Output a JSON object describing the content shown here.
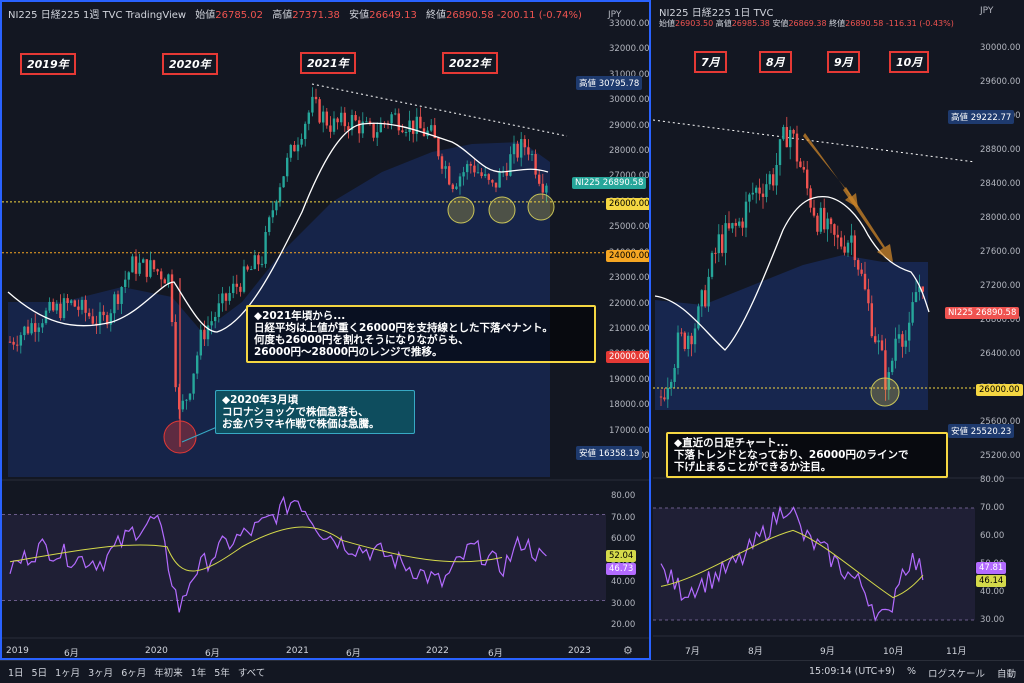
{
  "left": {
    "symbol": "NI225",
    "name": "日経225",
    "interval": "1週",
    "source": "TVC",
    "platform": "TradingView",
    "ohlc": {
      "o_label": "始値",
      "o": "26785.02",
      "h_label": "高値",
      "h": "27371.38",
      "l_label": "安値",
      "l": "26649.13",
      "c_label": "終値",
      "c": "26890.58",
      "chg": "-200.11 (-0.74%)"
    },
    "currency": "JPY",
    "price_axis": [
      "33000.00",
      "32000.00",
      "31000.00",
      "30000.00",
      "29000.00",
      "28000.00",
      "27000.00",
      "26000.00",
      "25000.00",
      "24000.00",
      "23000.00",
      "22000.00",
      "21000.00",
      "20000.00",
      "19000.00",
      "18000.00",
      "17000.00",
      "16000.00"
    ],
    "tags": {
      "high_label": "高値",
      "high": "30795.78",
      "symbol": "NI225",
      "last": "26890.58",
      "level1": "26000.00",
      "level2": "24000.00",
      "level3": "20000.00",
      "low_label": "安値",
      "low": "16358.19"
    },
    "year_labels": [
      "2019年",
      "2020年",
      "2021年",
      "2022年"
    ],
    "note_2021": {
      "title": "◆2021年頃から...",
      "l1": "日経平均は上値が重く26000円を支持線とした下落ペナント。",
      "l2": "何度も26000円を割れそうになりながらも、",
      "l3": "26000円〜28000円のレンジで推移。"
    },
    "note_2020": {
      "title": "◆2020年3月頃",
      "l1": "コロナショックで株価急落も、",
      "l2": "お金バラマキ作戦で株価は急騰。"
    },
    "rsi_axis": [
      "80.00",
      "70.00",
      "60.00",
      "50.00",
      "40.00",
      "30.00",
      "20.00"
    ],
    "rsi_tags": {
      "a": "52.04",
      "b": "46.73"
    },
    "x_labels": [
      "2019",
      "6月",
      "2020",
      "6月",
      "2021",
      "6月",
      "2022",
      "6月",
      "2023"
    ]
  },
  "right": {
    "symbol": "NI225",
    "name": "日経225",
    "interval": "1日",
    "source": "TVC",
    "ohlc": {
      "o_label": "始値",
      "o": "26903.50",
      "h_label": "高値",
      "h": "26985.38",
      "l_label": "安値",
      "l": "26869.38",
      "c_label": "終値",
      "c": "26890.58",
      "chg": "-116.31 (-0.43%)"
    },
    "currency": "JPY",
    "price_axis": [
      "30000.00",
      "29600.00",
      "29200.00",
      "28800.00",
      "28400.00",
      "28000.00",
      "27600.00",
      "27200.00",
      "26800.00",
      "26400.00",
      "26000.00",
      "25600.00",
      "25200.00"
    ],
    "tags": {
      "high_label": "高値",
      "high": "29222.77",
      "symbol": "NI225",
      "last": "26890.58",
      "level": "26000.00",
      "low_label": "安値",
      "low": "25520.23"
    },
    "month_labels": [
      "7月",
      "8月",
      "9月",
      "10月"
    ],
    "note": {
      "title": "◆直近の日足チャート...",
      "l1": "下落トレンドとなっており、26000円のラインで",
      "l2": "下げ止まることができるか注目。"
    },
    "rsi_axis": [
      "80.00",
      "70.00",
      "60.00",
      "50.00",
      "40.00",
      "30.00"
    ],
    "rsi_tags": {
      "a": "47.81",
      "b": "46.14"
    },
    "x_labels": [
      "7月",
      "8月",
      "9月",
      "10月",
      "11月"
    ]
  },
  "bottom": {
    "timeframes": [
      "1日",
      "5日",
      "1ヶ月",
      "3ヶ月",
      "6ヶ月",
      "年初来",
      "1年",
      "5年",
      "すべて"
    ],
    "time": "15:09:14 (UTC+9)",
    "percent": "%",
    "log": "ログスケール",
    "auto": "自動"
  },
  "colors": {
    "up": "#26a69a",
    "down": "#ef5350",
    "ma": "#ffffff",
    "rsi": "#b36bff",
    "rsi_ma": "#d4d94a",
    "bg": "#131722",
    "accent": "#2962ff"
  }
}
